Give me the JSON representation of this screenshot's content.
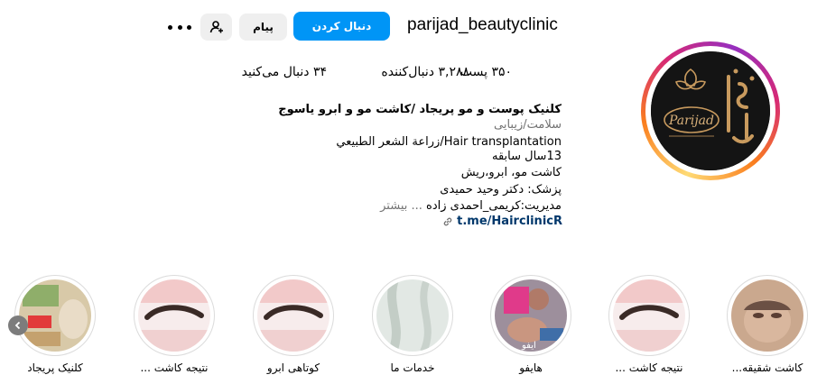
{
  "header": {
    "username": "parijad_beautyclinic",
    "follow_label": "دنبال کردن",
    "message_label": "پیام",
    "suggest_icon": "person-add-icon",
    "more_icon": "more-options-icon"
  },
  "stats": {
    "posts": "۳۵۰ پست",
    "followers": "۳,۲۸۸ دنبال‌کننده",
    "following": "۳۴ دنبال می‌کنید"
  },
  "bio": {
    "name": "کلنیک پوست و مو پریجاد /کاشت مو و ابرو یاسوج",
    "category": "سلامت/زیبایی",
    "lines": [
      "Hair transplantation/زراعة الشعر الطبيعي",
      "13سال سابقه",
      "کاشت مو، ابرو،ریش",
      "پزشک: دکتر وحید حمیدی"
    ],
    "last_line": "مدیریت:کریمی_احمدی زاده",
    "more_label": "... بیشتر",
    "link": "t.me/HairclinicR",
    "link_icon": "link-icon"
  },
  "avatar": {
    "brand": "Parijad"
  },
  "highlights": [
    {
      "label": "کاشت شقیقه..."
    },
    {
      "label": "نتیجه کاشت ..."
    },
    {
      "label": "هایفو"
    },
    {
      "label": "خدمات ما"
    },
    {
      "label": "کوتاهی ابرو"
    },
    {
      "label": "نتیجه کاشت ..."
    },
    {
      "label": "کلنیک پریجاد"
    }
  ],
  "colors": {
    "accent": "#0095f6",
    "link": "#00376b",
    "secondary_text": "#737373"
  }
}
